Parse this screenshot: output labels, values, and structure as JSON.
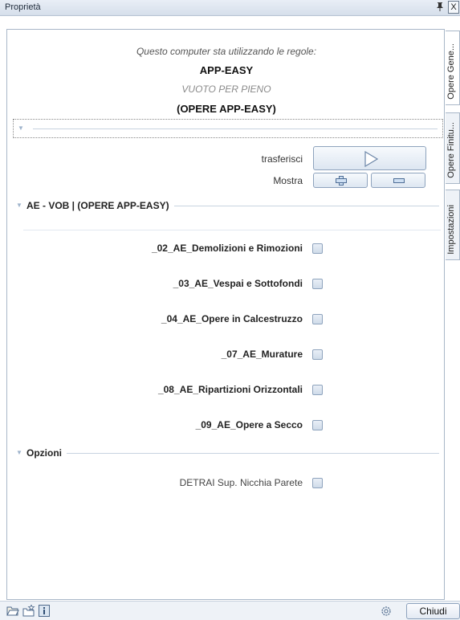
{
  "window": {
    "title": "Proprietà",
    "pin_glyph": "ᵖ",
    "close_glyph": "X"
  },
  "rules": {
    "intro": "Questo computer sta utilizzando le regole:",
    "name": "APP-EASY",
    "subtitle": "VUOTO PER PIENO",
    "group": "(OPERE APP-EASY)"
  },
  "actions": {
    "transfer_label": "trasferisci",
    "show_label": "Mostra"
  },
  "sections": {
    "main": "AE - VOB | (OPERE APP-EASY)",
    "options": "Opzioni"
  },
  "items": [
    {
      "label": "_02_AE_Demolizioni e Rimozioni",
      "checked": false
    },
    {
      "label": "_03_AE_Vespai e Sottofondi",
      "checked": false
    },
    {
      "label": "_04_AE_Opere in Calcestruzzo",
      "checked": false
    },
    {
      "label": "_07_AE_Murature",
      "checked": false
    },
    {
      "label": "_08_AE_Ripartizioni Orizzontali",
      "checked": false
    },
    {
      "label": "_09_AE_Opere a Secco",
      "checked": false
    }
  ],
  "options": [
    {
      "label": "DETRAI Sup. Nicchia Parete",
      "checked": false
    }
  ],
  "side_tabs": [
    "Opere Gene...",
    "Opere Finitu...",
    "Impostazioni"
  ],
  "footer": {
    "close_label": "Chiudi"
  },
  "icons": [
    "open-folder-icon",
    "favorite-folder-icon",
    "info-icon",
    "settings-gear-icon",
    "play-icon",
    "expand-all-icon",
    "collapse-all-icon"
  ]
}
